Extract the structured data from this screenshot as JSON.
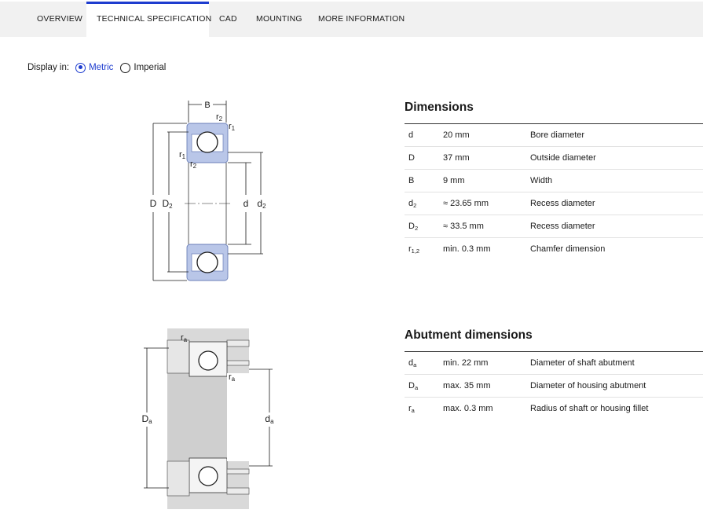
{
  "tabs": [
    {
      "label": "OVERVIEW"
    },
    {
      "label": "TECHNICAL SPECIFICATION"
    },
    {
      "label": "CAD"
    },
    {
      "label": "MOUNTING"
    },
    {
      "label": "MORE INFORMATION"
    }
  ],
  "display": {
    "label": "Display in:",
    "options": [
      {
        "label": "Metric",
        "selected": true
      },
      {
        "label": "Imperial",
        "selected": false
      }
    ]
  },
  "dimensions": {
    "title": "Dimensions",
    "rows": [
      {
        "symbol": "d",
        "sub": "",
        "value": "20 mm",
        "description": "Bore diameter"
      },
      {
        "symbol": "D",
        "sub": "",
        "value": "37 mm",
        "description": "Outside diameter"
      },
      {
        "symbol": "B",
        "sub": "",
        "value": "9 mm",
        "description": "Width"
      },
      {
        "symbol": "d",
        "sub": "2",
        "value": "≈ 23.65 mm",
        "description": "Recess diameter"
      },
      {
        "symbol": "D",
        "sub": "2",
        "value": "≈ 33.5 mm",
        "description": "Recess diameter"
      },
      {
        "symbol": "r",
        "sub": "1,2",
        "value": "min. 0.3 mm",
        "description": "Chamfer dimension"
      }
    ]
  },
  "abutment": {
    "title": "Abutment dimensions",
    "rows": [
      {
        "symbol": "d",
        "sub": "a",
        "value": "min. 22 mm",
        "description": "Diameter of shaft abutment"
      },
      {
        "symbol": "D",
        "sub": "a",
        "value": "max. 35 mm",
        "description": "Diameter of housing abutment"
      },
      {
        "symbol": "r",
        "sub": "a",
        "value": "max. 0.3 mm",
        "description": "Radius of shaft or housing fillet"
      }
    ]
  },
  "drawing1": {
    "labels": {
      "B": "B",
      "r1": "r",
      "r1_sub": "1",
      "r2": "r",
      "r2_sub": "2",
      "D": "D",
      "D2": "D",
      "D2_sub": "2",
      "d": "d",
      "d2": "d",
      "d2_sub": "2"
    }
  },
  "drawing2": {
    "labels": {
      "ra": "r",
      "ra_sub": "a",
      "Da": "D",
      "Da_sub": "a",
      "da": "d",
      "da_sub": "a"
    }
  },
  "colors": {
    "accent": "#1d3ccf",
    "ring_fill": "#b9c6e8",
    "ring_stroke": "#6b7fb8",
    "shaft_grey": "#d4d4d4"
  }
}
